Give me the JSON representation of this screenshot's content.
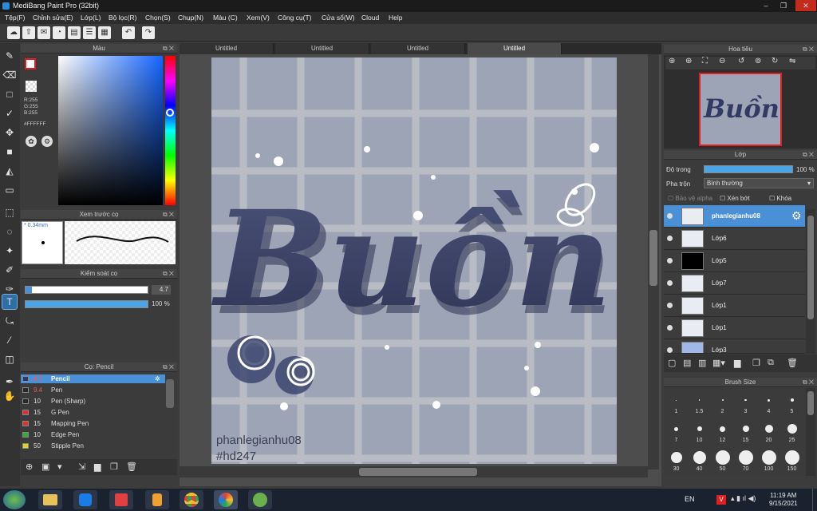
{
  "app": {
    "title": "MediBang Paint Pro (32bit)"
  },
  "menu": [
    "Tệp(F)",
    "Chỉnh sửa(E)",
    "Lớp(L)",
    "Bộ lọc(R)",
    "Chọn(S)",
    "Chụp(N)",
    "Màu (C)",
    "Xem(V)",
    "Công cụ(T)",
    "Cửa sổ(W)",
    "Cloud",
    "Help"
  ],
  "tabs": [
    "Untitled",
    "Untitled",
    "Untitled",
    "Untitled"
  ],
  "color_panel": {
    "title": "Màu",
    "r": "R:255",
    "g": "G:255",
    "b": "B:255",
    "hex": "#FFFFFF"
  },
  "brush_preview": {
    "title": "Xem trước cọ",
    "size": "0.34mm"
  },
  "brush_control": {
    "title": "Kiểm soát cọ",
    "size": "4.7",
    "opacity": "100",
    "pct": "%"
  },
  "brush_panel": {
    "title": "Cọ: Pencil",
    "items": [
      {
        "size": "4.7",
        "name": "Pencil",
        "color": "#2a3a70"
      },
      {
        "size": "9.4",
        "name": "Pen",
        "color": "#2a2a2a"
      },
      {
        "size": "10",
        "name": "Pen (Sharp)",
        "color": "#2a2a2a"
      },
      {
        "size": "15",
        "name": "G Pen",
        "color": "#e03030"
      },
      {
        "size": "15",
        "name": "Mapping Pen",
        "color": "#e03030"
      },
      {
        "size": "10",
        "name": "Edge Pen",
        "color": "#30b030"
      },
      {
        "size": "50",
        "name": "Stipple Pen",
        "color": "#e0d020"
      }
    ]
  },
  "navigator": {
    "title": "Hoa tiêu"
  },
  "layers_panel": {
    "title": "Lớp",
    "opacity_label": "Độ trong",
    "opacity_value": "100 %",
    "blend_label": "Pha trộn",
    "blend_value": "Bình thường",
    "protect_alpha": "Bảo vệ alpha",
    "clip": "Xén bớt",
    "lock": "Khóa",
    "layers": [
      "phanlegianhu08",
      "Lớp6",
      "Lớp5",
      "Lớp7",
      "Lớp1",
      "Lớp1",
      "Lớp3"
    ]
  },
  "brush_size": {
    "title": "Brush Size",
    "sizes": [
      "1",
      "1.5",
      "2",
      "3",
      "4",
      "5",
      "7",
      "10",
      "12",
      "15",
      "20",
      "25",
      "30",
      "40",
      "50",
      "70",
      "100",
      "150"
    ]
  },
  "artwork": {
    "word": "Buồn",
    "sig1": "phanlegianhu08",
    "sig2": "#hd247"
  },
  "taskbar": {
    "lang": "EN",
    "time": "11:19 AM",
    "date": "9/15/2021"
  },
  "colors": {
    "accent": "#4a90d6",
    "canvas_bg": "#9da4b6",
    "text_fill": "#3d4566"
  }
}
